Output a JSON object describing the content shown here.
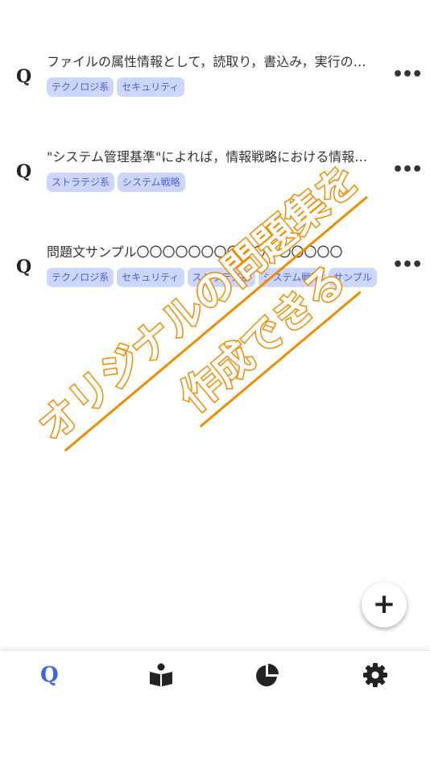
{
  "items": [
    {
      "icon": "Q",
      "text": "ファイルの属性情報として，読取り，書込み，実行の権限を…",
      "tags": [
        "テクノロジ系",
        "セキュリティ"
      ]
    },
    {
      "icon": "Q",
      "text": "\"システム管理基準\"によれば，情報戦略における情報システム…",
      "tags": [
        "ストラテジ系",
        "システム戦略"
      ]
    },
    {
      "icon": "Q",
      "text": "問題文サンプル〇〇〇〇〇〇〇〇〇〇〇〇〇〇〇〇",
      "tags": [
        "テクノロジ系",
        "セキュリティ",
        "ストラテジ系",
        "システム戦略",
        "サンプル"
      ]
    }
  ],
  "more_label": "•••",
  "fab_label": "+",
  "tabbar": {
    "tabs": [
      {
        "name": "questions",
        "icon": "q-icon",
        "label": "Q",
        "active": true
      },
      {
        "name": "study",
        "icon": "reading-book-icon",
        "active": false
      },
      {
        "name": "stats",
        "icon": "pie-chart-icon",
        "active": false
      },
      {
        "name": "settings",
        "icon": "gear-icon",
        "active": false
      }
    ]
  },
  "overlay": {
    "line1": "オリジナルの問題集を",
    "line2": "作成できる",
    "color": "#f08c00"
  },
  "colors": {
    "accent": "#3f63e8",
    "tag_bg": "#cdd6ff",
    "tag_text": "#4b5fd6"
  }
}
